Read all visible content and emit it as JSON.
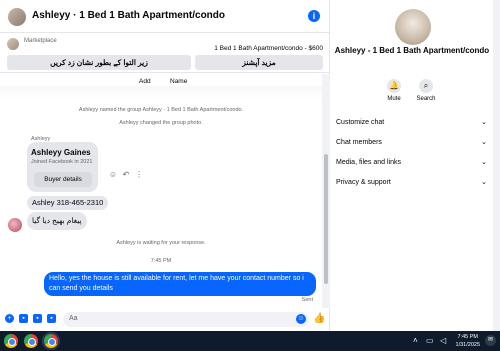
{
  "header": {
    "title": "Ashleyy · 1 Bed 1 Bath Apartment/condo",
    "info_icon": "i"
  },
  "marketplace": {
    "label": "Marketplace",
    "listing": "1 Bed 1 Bath Apartment/condo - $600",
    "button_left": "زیر التوا کے بطور نشان زد کریں",
    "button_right": "مزید آپشنز"
  },
  "messages": {
    "col_add": "Add",
    "col_name": "Name",
    "system_1": "Ashleyy named the group Ashleyy · 1 Bed 1 Bath Apartment/condo.",
    "system_2": "Ashleyy changed the group photo.",
    "sender_name": "Ashleyy",
    "card_name": "Ashleyy Gaines",
    "card_sub": "Joined Facebook in 2021",
    "card_button": "Buyer details",
    "phone_msg": "Ashley 318-465-2310",
    "urdu_msg": "پیغام بھیج دیا گیا",
    "waiting": "Ashleyy is waiting for your response.",
    "time": "7:45 PM",
    "outgoing": "Hello, yes the house is still available for rent, let me have your contact number so i can send you  details",
    "sent": "Sent"
  },
  "composer": {
    "placeholder": "Aa"
  },
  "info": {
    "title": "Ashleyy - 1 Bed 1 Bath Apartment/condo",
    "mute": "Mute",
    "search": "Search",
    "sections": [
      "Customize chat",
      "Chat members",
      "Media, files and links",
      "Privacy & support"
    ]
  },
  "taskbar": {
    "time": "7:45 PM",
    "date": "1/31/2025"
  }
}
